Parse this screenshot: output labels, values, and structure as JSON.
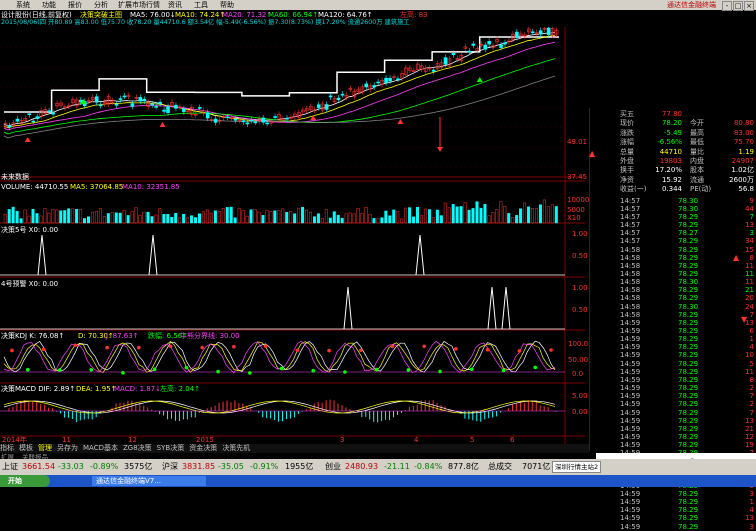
{
  "menu": {
    "items": [
      "系统",
      "功能",
      "报价",
      "分析",
      "扩展市场行情",
      "资讯",
      "工具",
      "帮助"
    ],
    "brand": "通达信金融终端",
    "window_controls": [
      "-",
      "□",
      "×"
    ]
  },
  "header": {
    "stock_title": "设计股份(日线,前复权)",
    "indicator_name": "决策突破主图",
    "ma5": "MA5: 76.00↓",
    "ma10": "MA10: 74.24↑",
    "ma20": "MA20: 71.32↑",
    "ma60": "MA60: 66.94↑",
    "ma120": "MA120: 64.76↑",
    "right_label": "左高: 83",
    "info_line": "2015/08/06(四 开80.89 高83.00 低75.70 收78.20 量44710.6 额3.54亿 幅-5.49(-6.56%) 振7.30(8.73%) 换17.20% 流通2600万 建筑施工"
  },
  "price_axis": {
    "mid": "49.01",
    "low": "37.45"
  },
  "label_future": "未来数据",
  "volume": {
    "title": "VOLUME: 44710.55",
    "ma5": "MA5: 37064.85",
    "ma10": "MA10: 32351.85",
    "axis": [
      "10000",
      "5000",
      "X10"
    ]
  },
  "signal1": {
    "title": "决策5号 X0: 0.00",
    "axis": [
      "1.00",
      "0.50"
    ]
  },
  "signal2": {
    "title": "4号预警 X0: 0.00",
    "axis": [
      "1.00",
      "0.50"
    ]
  },
  "kdj": {
    "title": "决策KDJ K: 76.08↑",
    "d": "D: 70.30↑",
    "j": "J: 87.63↑",
    "drop": "跌幅: 6.56↑",
    "line": "牛熊分界线: 30.00",
    "axis": [
      "100.0",
      "50.00",
      "0.0"
    ]
  },
  "macd": {
    "title": "决策MACD DIF: 2.89↑",
    "dea": "DEA: 1.95↑",
    "macd": "MACD: 1.87↓",
    "left": "左高: 2.04↑",
    "axis": [
      "5.00",
      "0.00"
    ]
  },
  "date_axis": {
    "labels": [
      "2014年",
      "11",
      "12",
      "2015",
      "3",
      "4",
      "5",
      "6"
    ],
    "right": "日线"
  },
  "tabs": [
    "指标",
    "模板",
    "管理",
    "另存为",
    "MACD基本",
    "ZG8决策",
    "SYB决策",
    "资金决策",
    "决策先机"
  ],
  "tab_sub": "扩展",
  "tab_sub2": "关联报品",
  "quote": {
    "rows": [
      {
        "label": "买五",
        "value": "77.80",
        "label2": "",
        "value2": "",
        "vcolor": "#ff3030"
      },
      {
        "label": "现价",
        "value": "78.20",
        "label2": "今开",
        "value2": "80.80",
        "vcolor": "#00ff00"
      },
      {
        "label": "涨跌",
        "value": "-5.49",
        "label2": "最高",
        "value2": "83.00",
        "vcolor": "#00ff00"
      },
      {
        "label": "涨幅",
        "value": "-6.56%",
        "label2": "最低",
        "value2": "75.70",
        "vcolor": "#00ff00"
      },
      {
        "label": "总量",
        "value": "44710",
        "label2": "量比",
        "value2": "1.19",
        "vcolor": "#ffff00"
      },
      {
        "label": "外盘",
        "value": "19803",
        "label2": "内盘",
        "value2": "24907",
        "vcolor": "#ff3030"
      },
      {
        "label": "换手",
        "value": "17.20%",
        "label2": "股本",
        "value2": "1.02亿",
        "vcolor": "#ffffff"
      },
      {
        "label": "净资",
        "value": "15.92",
        "label2": "流通",
        "value2": "2600万",
        "vcolor": "#ffffff"
      },
      {
        "label": "收益(一)",
        "value": "0.344",
        "label2": "PE(动)",
        "value2": "56.8",
        "vcolor": "#ffffff"
      }
    ],
    "ticks": [
      {
        "time": "14:57",
        "price": "78.30",
        "vol": "9",
        "c": "#ff3030"
      },
      {
        "time": "14:57",
        "price": "78.30",
        "vol": "44",
        "c": "#ff3030"
      },
      {
        "time": "14:57",
        "price": "78.29",
        "vol": "7",
        "c": "#00ff00"
      },
      {
        "time": "14:57",
        "price": "78.29",
        "vol": "13",
        "c": "#ff3030"
      },
      {
        "time": "14:57",
        "price": "78.27",
        "vol": "3",
        "c": "#00ff00"
      },
      {
        "time": "14:57",
        "price": "78.29",
        "vol": "34",
        "c": "#ff3030"
      },
      {
        "time": "14:58",
        "price": "78.29",
        "vol": "15",
        "c": "#ff3030"
      },
      {
        "time": "14:58",
        "price": "78.29",
        "vol": "8",
        "c": "#ff3030"
      },
      {
        "time": "14:58",
        "price": "78.29",
        "vol": "11",
        "c": "#ff3030"
      },
      {
        "time": "14:58",
        "price": "78.29",
        "vol": "11",
        "c": "#00ff00"
      },
      {
        "time": "14:58",
        "price": "78.30",
        "vol": "11",
        "c": "#ff3030"
      },
      {
        "time": "14:58",
        "price": "78.29",
        "vol": "21",
        "c": "#00ff00"
      },
      {
        "time": "14:58",
        "price": "78.29",
        "vol": "20",
        "c": "#ff3030"
      },
      {
        "time": "14:58",
        "price": "78.30",
        "vol": "24",
        "c": "#ff3030"
      },
      {
        "time": "14:58",
        "price": "78.29",
        "vol": "7",
        "c": "#ff3030"
      },
      {
        "time": "14:59",
        "price": "78.29",
        "vol": "13",
        "c": "#ff3030"
      },
      {
        "time": "14:59",
        "price": "78.29",
        "vol": "6",
        "c": "#ff3030"
      },
      {
        "time": "14:59",
        "price": "78.29",
        "vol": "1",
        "c": "#ff3030"
      },
      {
        "time": "14:59",
        "price": "78.29",
        "vol": "4",
        "c": "#ff3030"
      },
      {
        "time": "14:59",
        "price": "78.29",
        "vol": "10",
        "c": "#ff3030"
      },
      {
        "time": "14:59",
        "price": "78.29",
        "vol": "5",
        "c": "#ff3030"
      },
      {
        "time": "14:59",
        "price": "78.29",
        "vol": "11",
        "c": "#ff3030"
      },
      {
        "time": "14:59",
        "price": "78.29",
        "vol": "8",
        "c": "#ff3030"
      },
      {
        "time": "14:59",
        "price": "78.29",
        "vol": "2",
        "c": "#ff3030"
      },
      {
        "time": "14:59",
        "price": "78.29",
        "vol": "7",
        "c": "#ff3030"
      },
      {
        "time": "14:59",
        "price": "78.29",
        "vol": "2",
        "c": "#ff3030"
      },
      {
        "time": "14:59",
        "price": "78.29",
        "vol": "7",
        "c": "#ff3030"
      },
      {
        "time": "14:59",
        "price": "78.29",
        "vol": "13",
        "c": "#ff3030"
      },
      {
        "time": "14:59",
        "price": "78.29",
        "vol": "21",
        "c": "#ff3030"
      },
      {
        "time": "14:59",
        "price": "78.29",
        "vol": "12",
        "c": "#ff3030"
      },
      {
        "time": "14:59",
        "price": "78.29",
        "vol": "19",
        "c": "#ff3030"
      },
      {
        "time": "14:59",
        "price": "78.29",
        "vol": "7",
        "c": "#ff3030"
      },
      {
        "time": "14:59",
        "price": "78.29",
        "vol": "5",
        "c": "#ff3030"
      },
      {
        "time": "14:59",
        "price": "78.29",
        "vol": "13",
        "c": "#ff3030"
      },
      {
        "time": "14:59",
        "price": "78.29",
        "vol": "7",
        "c": "#ff3030"
      },
      {
        "time": "14:59",
        "price": "78.29",
        "vol": "5",
        "c": "#ff3030"
      },
      {
        "time": "14:59",
        "price": "78.29",
        "vol": "3",
        "c": "#ff3030"
      },
      {
        "time": "14:59",
        "price": "78.29",
        "vol": "1",
        "c": "#ff3030"
      },
      {
        "time": "14:59",
        "price": "78.29",
        "vol": "4",
        "c": "#ff3030"
      },
      {
        "time": "14:59",
        "price": "78.29",
        "vol": "13",
        "c": "#ff3030"
      },
      {
        "time": "14:59",
        "price": "78.29",
        "vol": "3",
        "c": "#ff3030"
      }
    ]
  },
  "status": {
    "sh_label": "上证",
    "sh_val": "3661.54",
    "sh_chg": "-33.03",
    "sh_pct": "-0.89%",
    "sh_amt": "3575亿",
    "hs_label": "沪深",
    "hs_val": "3831.85",
    "hs_chg": "-35.05",
    "hs_pct": "-0.91%",
    "hs_amt": "1955亿",
    "cy_label": "创业",
    "cy_val": "2480.93",
    "cy_chg": "-21.11",
    "cy_pct": "-0.84%",
    "cy_amt": "877.8亿",
    "total_label": "总成交",
    "total_val": "7071亿",
    "server": "深圳行情主站2"
  },
  "taskbar": {
    "start": "开始",
    "task": "通达信金融终端V7..."
  },
  "watermark": "www.7gpzb.com"
}
